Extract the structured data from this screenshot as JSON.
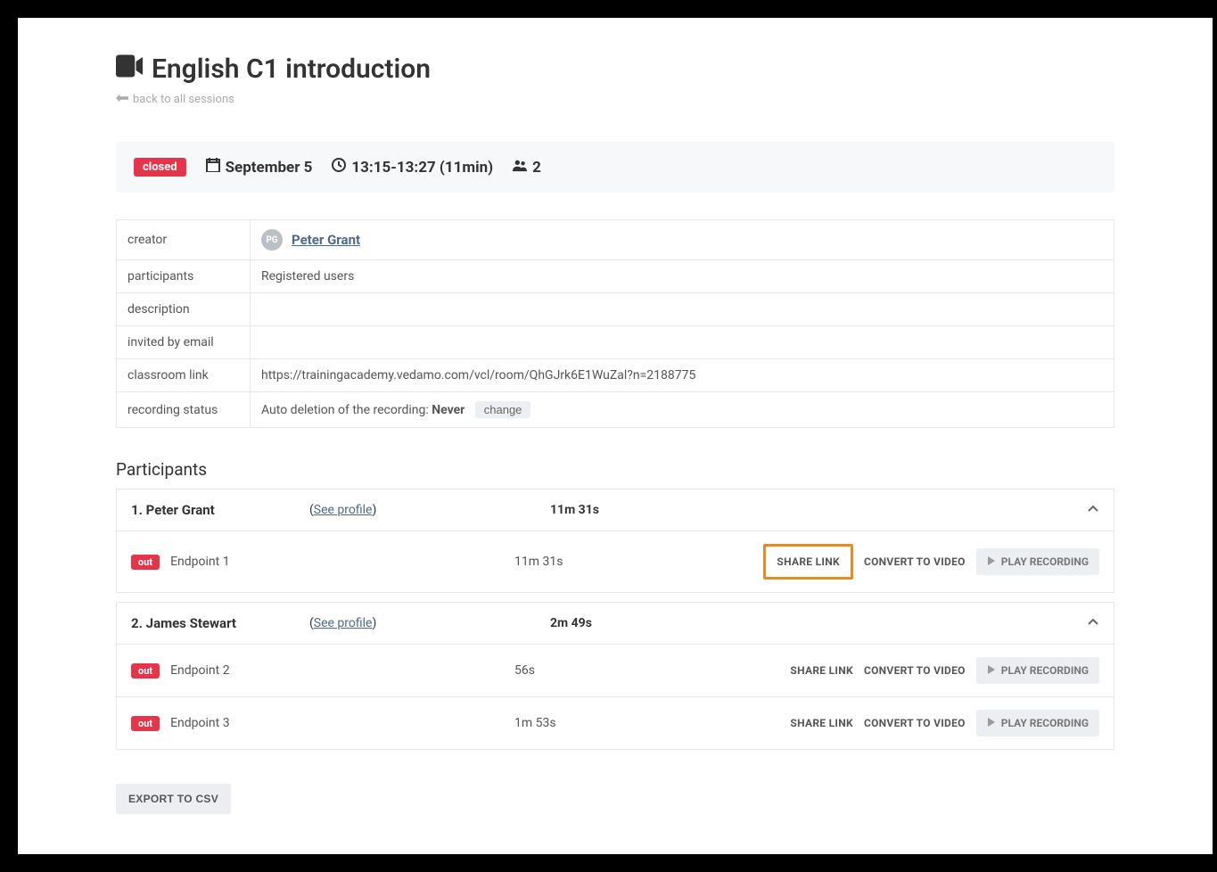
{
  "header": {
    "title": "English C1 introduction",
    "back_label": "back to all sessions"
  },
  "infobar": {
    "status": "closed",
    "date": "September 5",
    "time": "13:15-13:27 (11min)",
    "participant_count": "2"
  },
  "details": {
    "creator_label": "creator",
    "creator_initials": "PG",
    "creator_name": "Peter Grant",
    "participants_label": "participants",
    "participants_value": "Registered users",
    "description_label": "description",
    "description_value": "",
    "invited_label": "invited by email",
    "invited_value": "",
    "link_label": "classroom link",
    "link_value": "https://trainingacademy.vedamo.com/vcl/room/QhGJrk6E1WuZal?n=2188775",
    "recording_label": "recording status",
    "recording_prefix": "Auto deletion of the recording: ",
    "recording_value": "Never",
    "change_label": "change"
  },
  "participants_heading": "Participants",
  "actions": {
    "share": "SHARE LINK",
    "convert": "CONVERT TO VIDEO",
    "play": "PLAY RECORDING",
    "see_profile": "See profile",
    "out": "out"
  },
  "participants": [
    {
      "index_name": "1. Peter Grant",
      "total_duration": "11m 31s",
      "endpoints": [
        {
          "name": "Endpoint 1",
          "duration": "11m 31s",
          "highlight_share": true
        }
      ]
    },
    {
      "index_name": "2. James Stewart",
      "total_duration": "2m 49s",
      "endpoints": [
        {
          "name": "Endpoint 2",
          "duration": "56s",
          "highlight_share": false
        },
        {
          "name": "Endpoint 3",
          "duration": "1m 53s",
          "highlight_share": false
        }
      ]
    }
  ],
  "export_label": "EXPORT TO CSV"
}
